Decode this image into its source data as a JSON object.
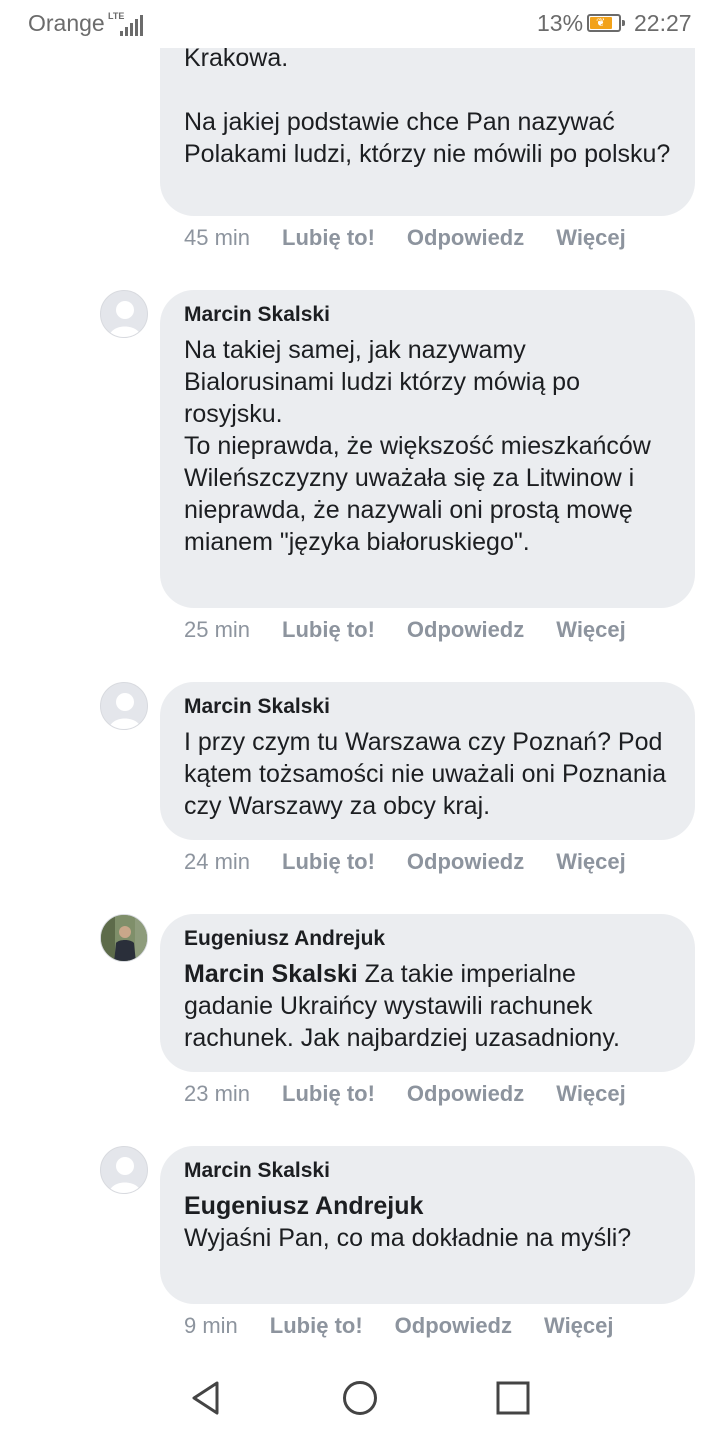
{
  "status_bar": {
    "carrier": "Orange",
    "network": "LTE",
    "battery": "13%",
    "battery_level": 0.13,
    "time": "22:27"
  },
  "comments": [
    {
      "text": "Krakowa.\n\nNa jakiej podstawie chce Pan nazywać Polakami ludzi, którzy nie mówili po polsku?",
      "time": "45 min",
      "like": "Lubię to!",
      "reply": "Odpowiedz",
      "more": "Więcej"
    },
    {
      "author": "Marcin Skalski",
      "text": "Na takiej samej, jak nazywamy Bialorusinami ludzi którzy mówią po rosyjsku.\nTo nieprawda, że większość mieszkańców Wileńszczyzny uważała się za Litwinow i nieprawda, że nazywali oni prostą mowę mianem \"języka białoruskiego\".",
      "time": "25 min",
      "like": "Lubię to!",
      "reply": "Odpowiedz",
      "more": "Więcej"
    },
    {
      "author": "Marcin Skalski",
      "text": "I przy czym tu Warszawa czy Poznań? Pod kątem tożsamości nie uważali oni Poznania czy Warszawy za obcy kraj.",
      "time": "24 min",
      "like": "Lubię to!",
      "reply": "Odpowiedz",
      "more": "Więcej"
    },
    {
      "author": "Eugeniusz Andrejuk",
      "mention": "Marcin Skalski",
      "text": " Za takie imperialne gadanie Ukraińcy wystawili rachunek rachunek. Jak najbardziej uzasadniony.",
      "time": "23 min",
      "like": "Lubię to!",
      "reply": "Odpowiedz",
      "more": "Więcej"
    },
    {
      "author": "Marcin Skalski",
      "mention": "Eugeniusz Andrejuk",
      "text": "Wyjaśni Pan, co ma dokładnie na myśli?",
      "time": "9 min",
      "like": "Lubię to!",
      "reply": "Odpowiedz",
      "more": "Więcej"
    }
  ],
  "colors": {
    "bubble": "#ebedf0",
    "meta_text": "#8d949e",
    "battery": "#f2a21a"
  }
}
